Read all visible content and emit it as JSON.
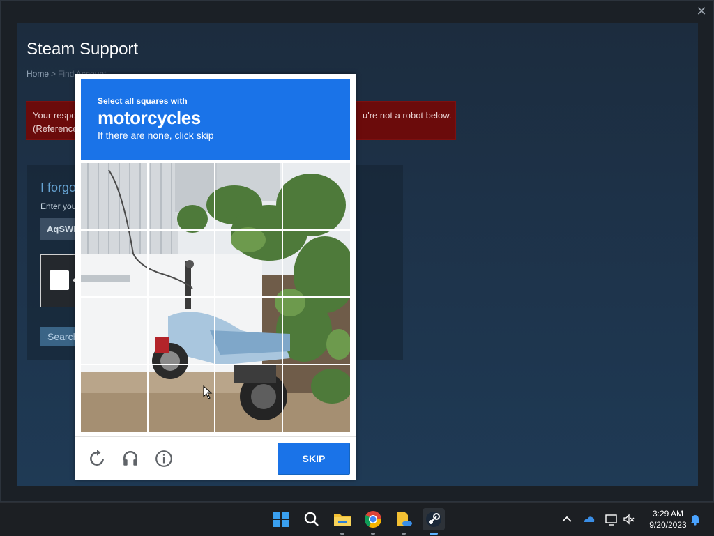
{
  "window": {
    "close_label": "✕"
  },
  "support": {
    "title": "Steam Support",
    "breadcrumb": {
      "home": "Home",
      "separator": ">",
      "current": "Find Account"
    }
  },
  "error": {
    "line1_start": "Your respo",
    "line1_end": "u're not a robot below.",
    "line2_start": "(Reference"
  },
  "form": {
    "heading": "I forgo",
    "enter_label": "Enter you",
    "input_value": "AqSWD",
    "search_label": "Search"
  },
  "captcha": {
    "instruction": "Select all squares with",
    "target": "motorcycles",
    "hint": "If there are none, click skip",
    "skip_label": "SKIP",
    "icons": [
      "reload-icon",
      "audio-icon",
      "info-icon"
    ],
    "tiles": 16
  },
  "taskbar": {
    "apps": [
      "windows-start",
      "search",
      "file-explorer",
      "chrome",
      "onedrive-files",
      "steam"
    ],
    "time": "3:29 AM",
    "date": "9/20/2023"
  },
  "colors": {
    "captcha_blue": "#1a73e8",
    "steam_bg": "#1d3147",
    "error_red": "#6b0b0b"
  }
}
